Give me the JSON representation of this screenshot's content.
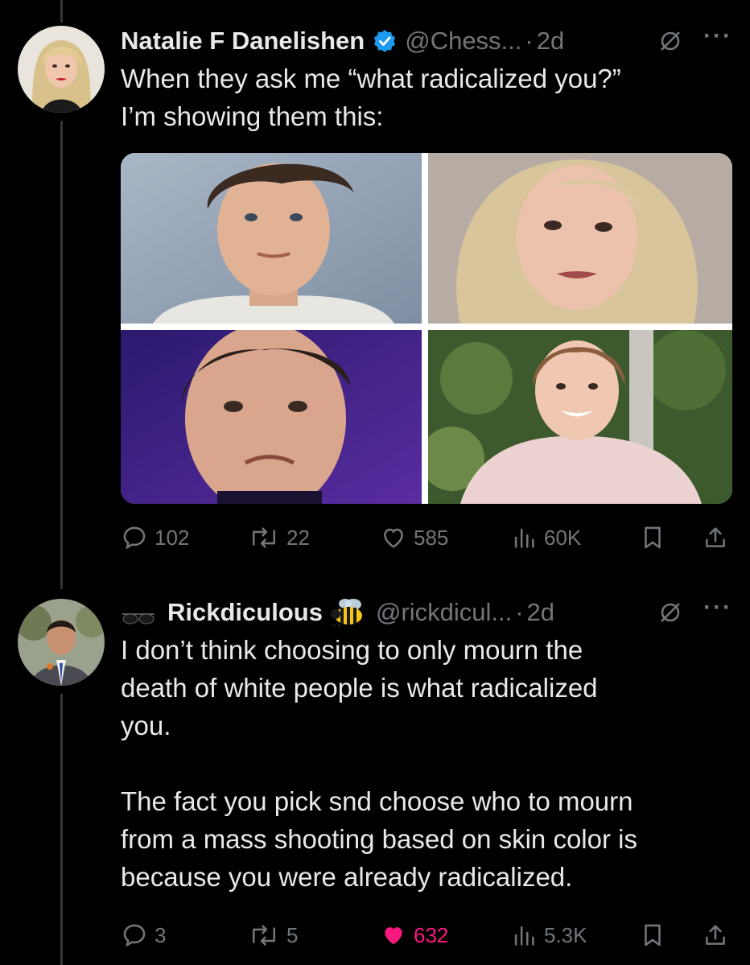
{
  "tweets": [
    {
      "author": "Natalie F Danelishen",
      "handle": "@Chess...",
      "separator": "·",
      "time": "2d",
      "verified": true,
      "text_line1": "When they ask me “what radicalized you?”",
      "text_line2": "I’m showing them this:",
      "media_count": 4,
      "stats": {
        "replies": "102",
        "retweets": "22",
        "likes": "585",
        "views": "60K"
      }
    },
    {
      "author_emoji": "sunglasses-icon",
      "author": "Rickdiculous",
      "author_emoji_after": "bee-icon",
      "handle": "@rickdicul...",
      "separator": "·",
      "time": "2d",
      "text_line1": "I don’t think choosing to only mourn the",
      "text_line2": "death of white people is what radicalized",
      "text_line3": "you.",
      "text_line4": "The fact you pick snd choose who to mourn",
      "text_line5": "from a mass shooting based on skin color is",
      "text_line6": "because you were already radicalized.",
      "stats": {
        "replies": "3",
        "retweets": "5",
        "likes": "632",
        "views": "5.3K"
      },
      "liked": true
    }
  ],
  "colors": {
    "background": "#000000",
    "text": "#e7e9ea",
    "muted": "#71767b",
    "like": "#f91880",
    "verified": "#1d9bf0"
  },
  "more_label": "···"
}
